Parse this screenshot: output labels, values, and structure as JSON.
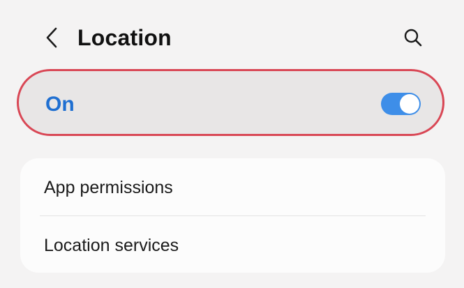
{
  "header": {
    "title": "Location",
    "back_icon": "chevron-left-icon",
    "search_icon": "search-icon"
  },
  "master_switch": {
    "label": "On",
    "state": "on",
    "accent_color": "#1f6fd1",
    "toggle_color": "#3e8ee8",
    "highlight_border_color": "#d94755"
  },
  "settings": {
    "items": [
      {
        "label": "App permissions"
      },
      {
        "label": "Location services"
      }
    ]
  }
}
